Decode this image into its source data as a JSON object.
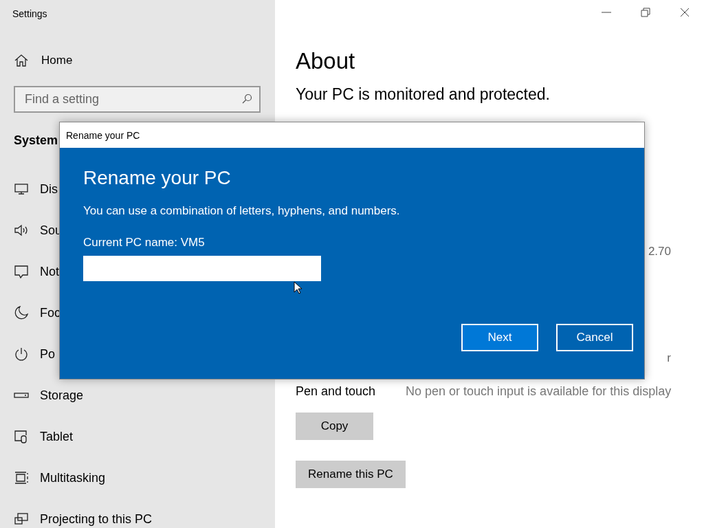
{
  "window": {
    "title": "Settings"
  },
  "sidebar": {
    "home": "Home",
    "search": {
      "placeholder": "Find a setting"
    },
    "section": "System",
    "items": [
      {
        "label": "Dis",
        "kind": "display"
      },
      {
        "label": "Sou",
        "kind": "sound"
      },
      {
        "label": "Not",
        "kind": "notifications"
      },
      {
        "label": "Foc",
        "kind": "focus"
      },
      {
        "label": "Po",
        "kind": "power"
      },
      {
        "label": "Storage",
        "kind": "storage"
      },
      {
        "label": "Tablet",
        "kind": "tablet"
      },
      {
        "label": "Multitasking",
        "kind": "multitasking"
      },
      {
        "label": "Projecting to this PC",
        "kind": "projecting"
      }
    ]
  },
  "main": {
    "heading": "About",
    "status": "Your PC is monitored and protected.",
    "fragments": [
      "2.70",
      "r"
    ],
    "pen_touch": {
      "label": "Pen and touch",
      "value": "No pen or touch input is available for this display"
    },
    "buttons": [
      "Copy",
      "Rename this PC"
    ]
  },
  "dialog": {
    "title": "Rename your PC",
    "heading": "Rename your PC",
    "description": "You can use a combination of letters, hyphens, and numbers.",
    "current_name": "Current PC name: VM5",
    "buttons": [
      {
        "label": "Next",
        "primary": true
      },
      {
        "label": "Cancel",
        "primary": false
      }
    ]
  }
}
